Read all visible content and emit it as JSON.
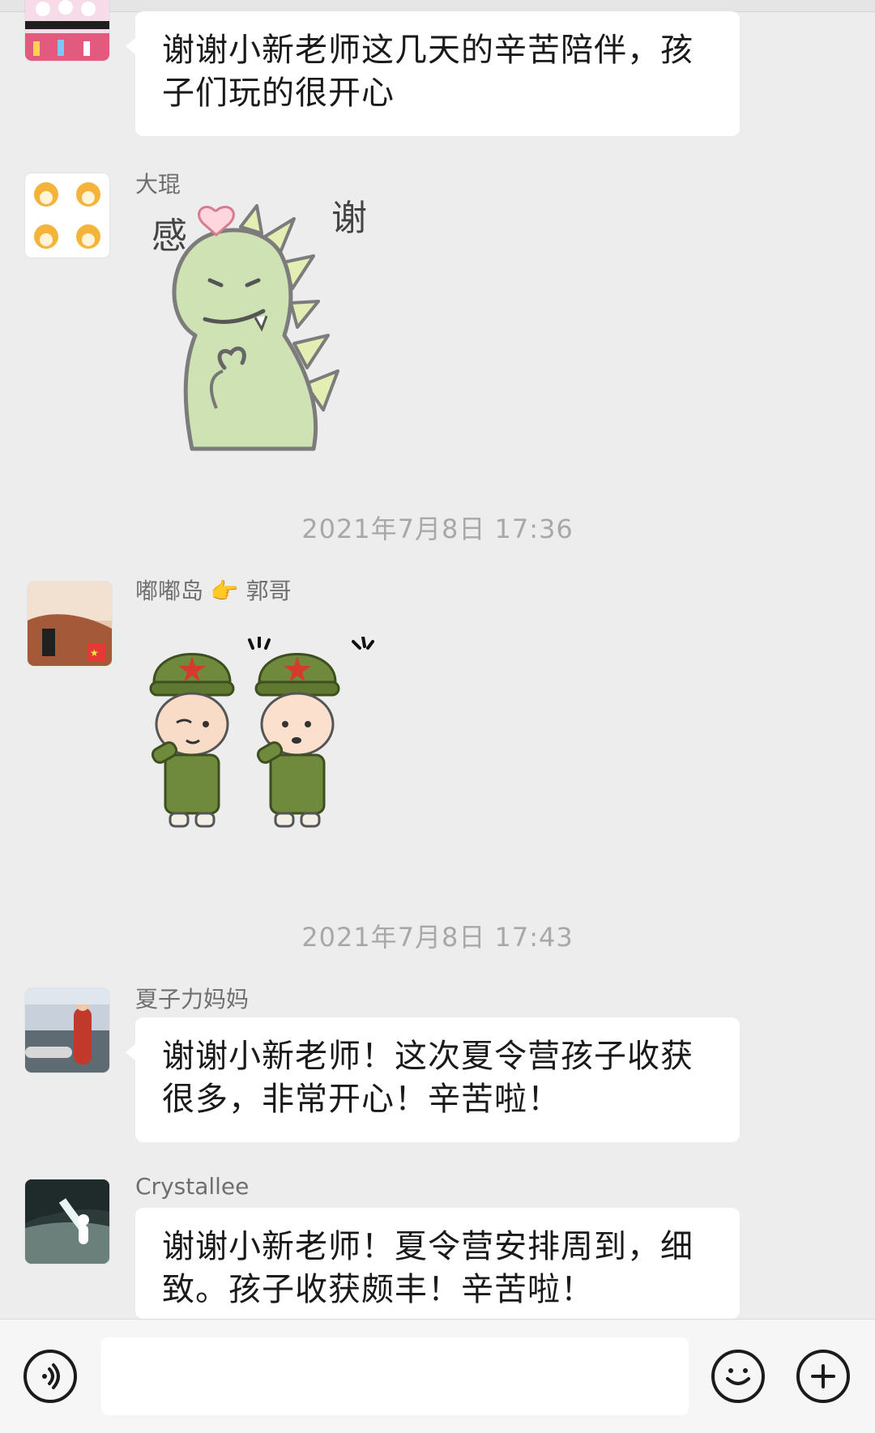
{
  "messages": [
    {
      "sender": "",
      "text": "谢谢小新老师这几天的辛苦陪伴，孩子们玩的很开心"
    },
    {
      "sender": "大琨",
      "sticker": "dinosaur-thanks-sticker",
      "sticker_text": [
        "感",
        "谢"
      ]
    },
    {
      "sender": "嘟嘟岛 👉 郭哥",
      "sticker": "soldier-salute-sticker"
    },
    {
      "sender": "夏子力妈妈",
      "text": "谢谢小新老师！这次夏令营孩子收获很多，非常开心！辛苦啦！"
    },
    {
      "sender": "Crystallee",
      "text": "谢谢小新老师！夏令营安排周到，细致。孩子收获颇丰！辛苦啦！"
    }
  ],
  "timestamps": [
    "2021年7月8日 17:36",
    "2021年7月8日 17:43"
  ],
  "input_bar": {
    "voice_icon": "voice-icon",
    "emoji_icon": "emoji-icon",
    "plus_icon": "plus-icon"
  },
  "colors": {
    "background": "#ededed",
    "bubble": "#ffffff",
    "dino_green": "#cfe2b3",
    "soldier_green": "#6f8a3c",
    "star_red": "#d33b2c"
  }
}
